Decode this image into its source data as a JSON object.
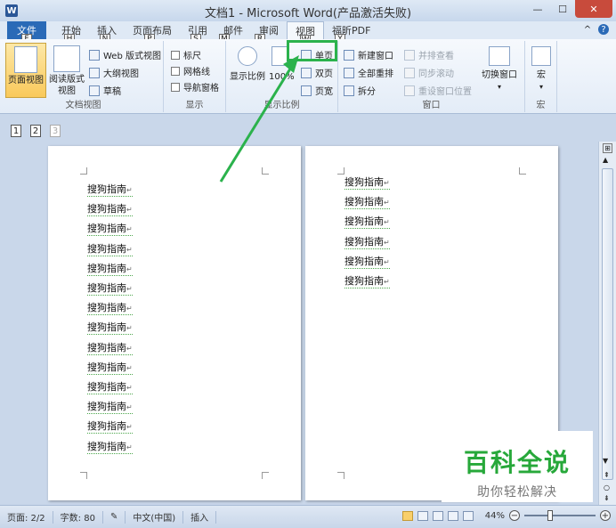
{
  "window": {
    "title": "文档1 - Microsoft Word(产品激活失败)",
    "app_icon": "W"
  },
  "tabs": [
    {
      "label": "开始",
      "keytip": "H"
    },
    {
      "label": "插入",
      "keytip": "N"
    },
    {
      "label": "页面布局",
      "keytip": "P"
    },
    {
      "label": "引用",
      "keytip": "S"
    },
    {
      "label": "邮件",
      "keytip": "M"
    },
    {
      "label": "审阅",
      "keytip": "R"
    },
    {
      "label": "视图",
      "keytip": "W"
    },
    {
      "label": "福昕PDF",
      "keytip": "Y"
    }
  ],
  "file_tab": {
    "label": "文件",
    "keytip": "F"
  },
  "ribbon": {
    "doc_views": {
      "label": "文档视图",
      "print_layout": "页面视图",
      "read_layout_1": "阅读版式",
      "read_layout_2": "视图",
      "web_layout": "Web 版式视图",
      "outline": "大纲视图",
      "draft": "草稿"
    },
    "show": {
      "label": "显示",
      "ruler": "标尺",
      "gridlines": "网格线",
      "nav_pane": "导航窗格"
    },
    "zoom": {
      "label": "显示比例",
      "zoom_btn": "显示比例",
      "hundred": "100%",
      "one_page": "单页",
      "two_pages": "双页",
      "page_width": "页宽"
    },
    "window": {
      "label": "窗口",
      "new_window": "新建窗口",
      "arrange_all": "全部重排",
      "split": "拆分",
      "side_by_side": "并排查看",
      "sync_scroll": "同步滚动",
      "reset_pos": "重设窗口位置",
      "switch_windows": "切换窗口"
    },
    "macros": {
      "label": "宏",
      "btn": "宏"
    }
  },
  "qat": {
    "num1": "1",
    "num2": "2",
    "num3": "3"
  },
  "document": {
    "page1_lines": [
      "搜狗指南",
      "搜狗指南",
      "搜狗指南",
      "搜狗指南",
      "搜狗指南",
      "搜狗指南",
      "搜狗指南",
      "搜狗指南",
      "搜狗指南",
      "搜狗指南",
      "搜狗指南",
      "搜狗指南",
      "搜狗指南",
      "搜狗指南"
    ],
    "page2_lines": [
      "搜狗指南",
      "搜狗指南",
      "搜狗指南",
      "搜狗指南",
      "搜狗指南",
      "搜狗指南"
    ],
    "para_mark": "↵"
  },
  "watermark": {
    "title": "百科全说",
    "subtitle": "助你轻松解决"
  },
  "statusbar": {
    "page": "页面: 2/2",
    "words": "字数: 80",
    "language": "中文(中国)",
    "mode": "插入",
    "zoom": "44%",
    "zoom_fraction": 0.44
  },
  "colors": {
    "highlight": "#2bb24c",
    "file_tab": "#2a6ab7"
  }
}
